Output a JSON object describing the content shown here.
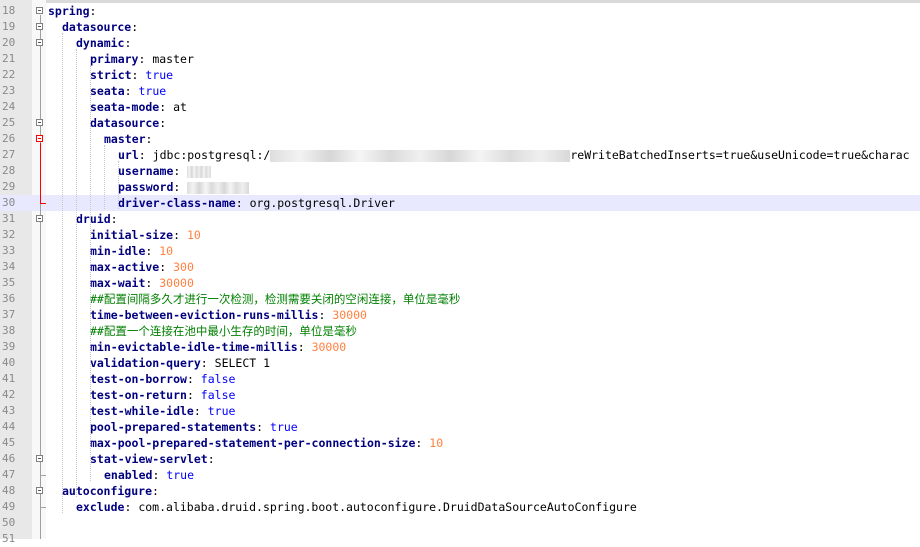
{
  "editor": {
    "current_line": 30,
    "lines": [
      {
        "n": "18",
        "indent": 0,
        "key": "spring",
        "sep": ":",
        "val": "",
        "type": ""
      },
      {
        "n": "19",
        "indent": 1,
        "key": "datasource",
        "sep": ":",
        "val": "",
        "type": ""
      },
      {
        "n": "20",
        "indent": 2,
        "key": "dynamic",
        "sep": ":",
        "val": "",
        "type": ""
      },
      {
        "n": "21",
        "indent": 3,
        "key": "primary",
        "sep": ": ",
        "val": "master",
        "type": "str"
      },
      {
        "n": "22",
        "indent": 3,
        "key": "strict",
        "sep": ": ",
        "val": "true",
        "type": "bool"
      },
      {
        "n": "23",
        "indent": 3,
        "key": "seata",
        "sep": ": ",
        "val": "true",
        "type": "bool"
      },
      {
        "n": "24",
        "indent": 3,
        "key": "seata-mode",
        "sep": ": ",
        "val": "at",
        "type": "str"
      },
      {
        "n": "25",
        "indent": 3,
        "key": "datasource",
        "sep": ":",
        "val": "",
        "type": ""
      },
      {
        "n": "26",
        "indent": 4,
        "key": "master",
        "sep": ":",
        "val": "",
        "type": ""
      },
      {
        "n": "27",
        "indent": 5,
        "key": "url",
        "sep": ": ",
        "val": "jdbc:postgresql:/",
        "type": "str",
        "redact": 300,
        "tail": "reWriteBatchedInserts=true&useUnicode=true&charac"
      },
      {
        "n": "28",
        "indent": 5,
        "key": "username",
        "sep": ": ",
        "val": "",
        "type": "str",
        "redact": 24
      },
      {
        "n": "29",
        "indent": 5,
        "key": "password",
        "sep": ": ",
        "val": "",
        "type": "str",
        "redact": 62
      },
      {
        "n": "30",
        "indent": 5,
        "key": "driver-class-name",
        "sep": ": ",
        "val": "org.postgresql.Driver",
        "type": "str"
      },
      {
        "n": "31",
        "indent": 2,
        "key": "druid",
        "sep": ":",
        "val": "",
        "type": ""
      },
      {
        "n": "32",
        "indent": 3,
        "key": "initial-size",
        "sep": ": ",
        "val": "10",
        "type": "num"
      },
      {
        "n": "33",
        "indent": 3,
        "key": "min-idle",
        "sep": ": ",
        "val": "10",
        "type": "num"
      },
      {
        "n": "34",
        "indent": 3,
        "key": "max-active",
        "sep": ": ",
        "val": "300",
        "type": "num"
      },
      {
        "n": "35",
        "indent": 3,
        "key": "max-wait",
        "sep": ": ",
        "val": "30000",
        "type": "num"
      },
      {
        "n": "36",
        "indent": 3,
        "key": "",
        "sep": "",
        "val": "##配置间隔多久才进行一次检测，检测需要关闭的空闲连接，单位是毫秒",
        "type": "cmt"
      },
      {
        "n": "37",
        "indent": 3,
        "key": "time-between-eviction-runs-millis",
        "sep": ": ",
        "val": "30000",
        "type": "num"
      },
      {
        "n": "38",
        "indent": 3,
        "key": "",
        "sep": "",
        "val": "##配置一个连接在池中最小生存的时间，单位是毫秒",
        "type": "cmt"
      },
      {
        "n": "39",
        "indent": 3,
        "key": "min-evictable-idle-time-millis",
        "sep": ": ",
        "val": "30000",
        "type": "num"
      },
      {
        "n": "40",
        "indent": 3,
        "key": "validation-query",
        "sep": ": ",
        "val": "SELECT 1",
        "type": "str"
      },
      {
        "n": "41",
        "indent": 3,
        "key": "test-on-borrow",
        "sep": ": ",
        "val": "false",
        "type": "bool"
      },
      {
        "n": "42",
        "indent": 3,
        "key": "test-on-return",
        "sep": ": ",
        "val": "false",
        "type": "bool"
      },
      {
        "n": "43",
        "indent": 3,
        "key": "test-while-idle",
        "sep": ": ",
        "val": "true",
        "type": "bool"
      },
      {
        "n": "44",
        "indent": 3,
        "key": "pool-prepared-statements",
        "sep": ": ",
        "val": "true",
        "type": "bool"
      },
      {
        "n": "45",
        "indent": 3,
        "key": "max-pool-prepared-statement-per-connection-size",
        "sep": ": ",
        "val": "10",
        "type": "num"
      },
      {
        "n": "46",
        "indent": 3,
        "key": "stat-view-servlet",
        "sep": ":",
        "val": "",
        "type": ""
      },
      {
        "n": "47",
        "indent": 4,
        "key": "enabled",
        "sep": ": ",
        "val": "true",
        "type": "bool"
      },
      {
        "n": "48",
        "indent": 1,
        "key": "autoconfigure",
        "sep": ":",
        "val": "",
        "type": ""
      },
      {
        "n": "49",
        "indent": 2,
        "key": "exclude",
        "sep": ": ",
        "val": "com.alibaba.druid.spring.boot.autoconfigure.DruidDataSourceAutoConfigure",
        "type": "str"
      },
      {
        "n": "50",
        "indent": 0,
        "key": "",
        "sep": "",
        "val": "",
        "type": ""
      },
      {
        "n": "51",
        "indent": 0,
        "key": "",
        "sep": "",
        "val": "",
        "type": ""
      }
    ]
  }
}
